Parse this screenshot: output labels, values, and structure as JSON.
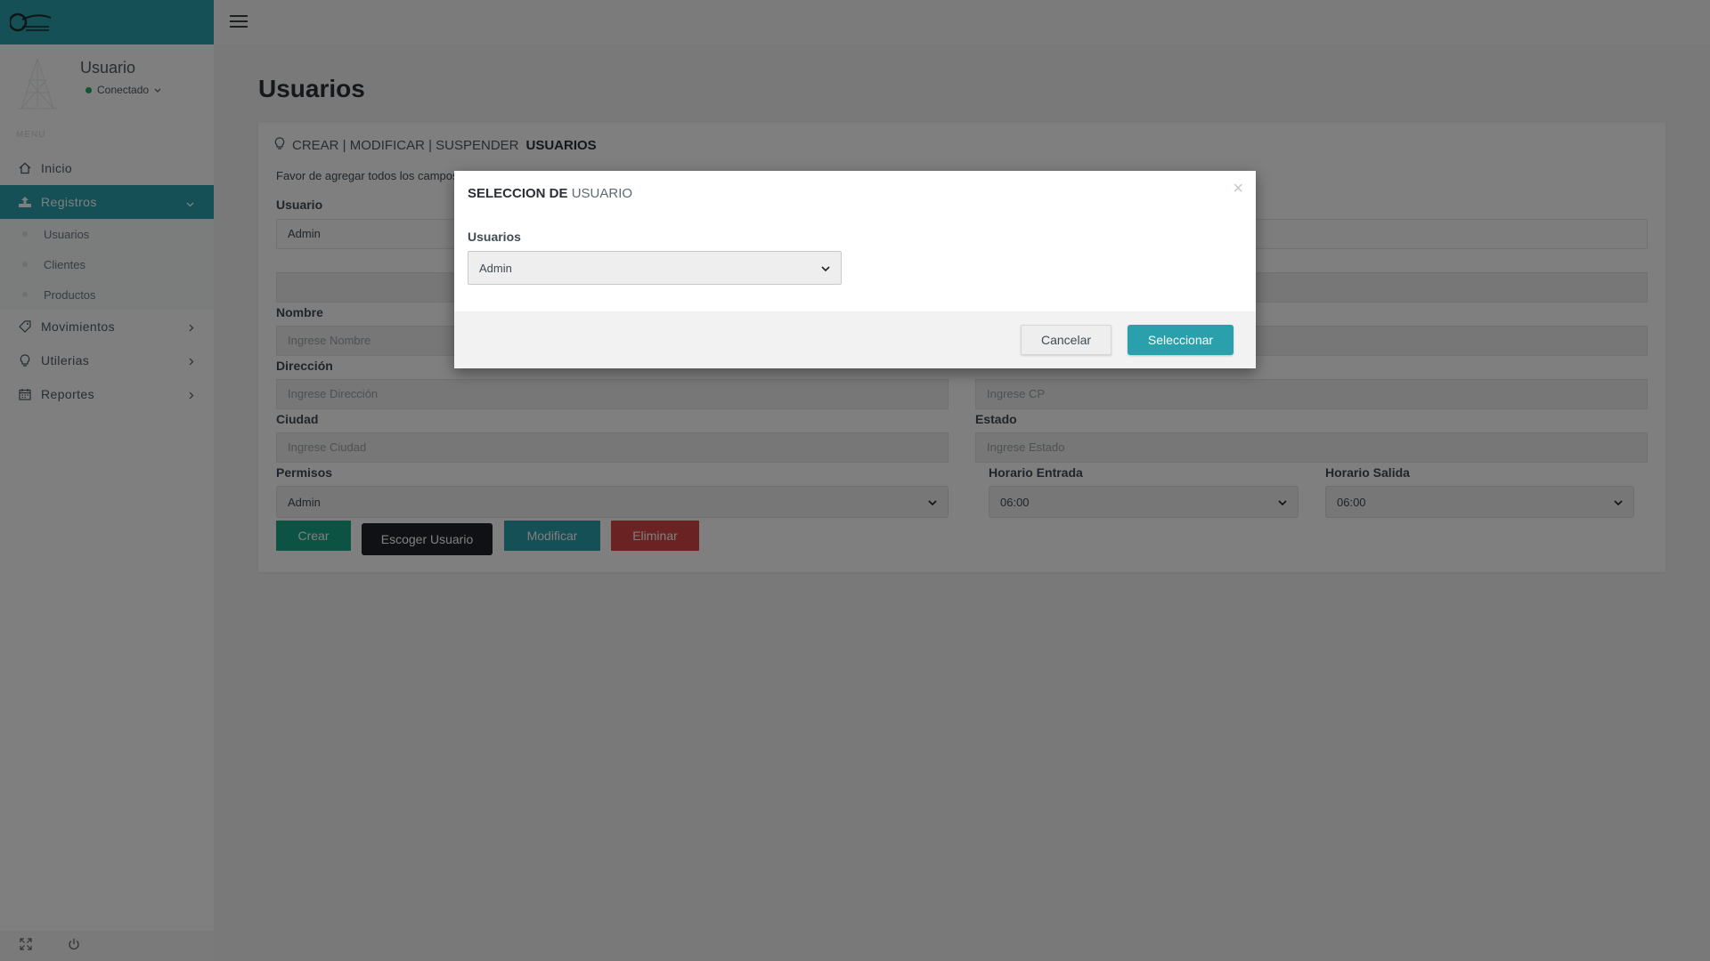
{
  "sidebar": {
    "user_name": "Usuario",
    "user_status": "Conectado",
    "menu_label": "MENU",
    "nav": {
      "inicio": "Inicio",
      "registros": "Registros",
      "movimientos": "Movimientos",
      "utilerias": "Utilerias",
      "reportes": "Reportes"
    },
    "sub_items": {
      "usuarios": "Usuarios",
      "clientes": "Clientes",
      "productos": "Productos"
    }
  },
  "page": {
    "title": "Usuarios",
    "panel": {
      "heading_prefix": "CREAR | MODIFICAR | SUSPENDER",
      "heading_bold": "USUARIOS",
      "description": "Favor de agregar todos los campos"
    },
    "form": {
      "usuario_label": "Usuario",
      "usuario_value": "Admin",
      "nombre_label": "Nombre",
      "nombre_placeholder": "Ingrese Nombre",
      "direccion_label": "Dirección",
      "direccion_placeholder": "Ingrese Dirección",
      "cp_placeholder": "Ingrese CP",
      "ciudad_label": "Ciudad",
      "ciudad_placeholder": "Ingrese Ciudad",
      "estado_label": "Estado",
      "estado_placeholder": "Ingrese Estado",
      "permisos_label": "Permisos",
      "permisos_value": "Admin",
      "horario_entrada_label": "Horario Entrada",
      "horario_entrada_value": "06:00",
      "horario_salida_label": "Horario Salida",
      "horario_salida_value": "06:00"
    },
    "buttons": {
      "crear": "Crear",
      "escoger": "Escoger Usuario",
      "modificar": "Modificar",
      "eliminar": "Eliminar"
    }
  },
  "modal": {
    "title_bold": "SELECCION DE",
    "title_light": "USUARIO",
    "close": "×",
    "field_label": "Usuarios",
    "selected": "Admin",
    "cancel": "Cancelar",
    "confirm": "Seleccionar"
  },
  "colors": {
    "accent": "#2aa0ad",
    "success": "#1ba686",
    "danger": "#d64545",
    "dark": "#1f2328"
  }
}
